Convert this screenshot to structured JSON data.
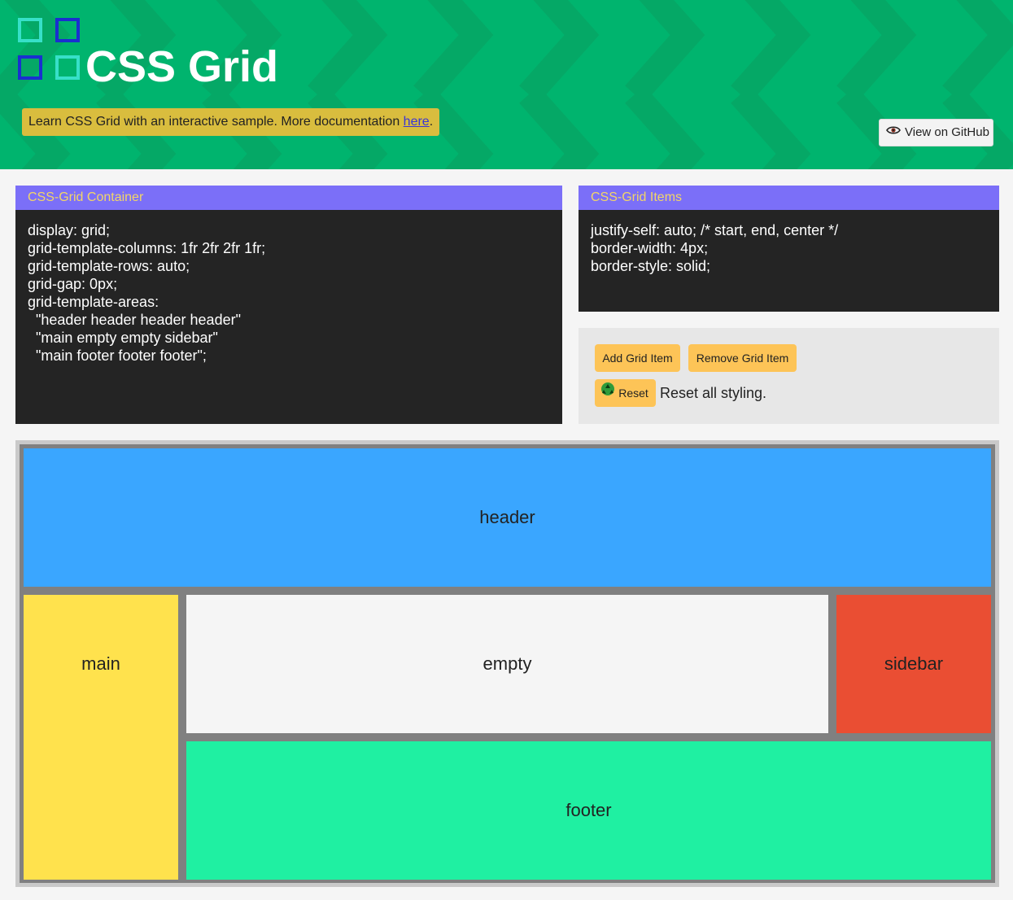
{
  "hero": {
    "title": "CSS Grid",
    "tagline_text": "Learn CSS Grid with an interactive sample. More documentation ",
    "tagline_link": "here",
    "tagline_end": ".",
    "github_button": "View on GitHub",
    "github_icon": "eye-icon",
    "logo_icon": "grid-logo-icon",
    "colors": {
      "background": "#00b46e",
      "chevron": "#06a866",
      "tagline_bg": "#d9bd3e"
    }
  },
  "container_panel": {
    "title": "CSS-Grid Container",
    "lines": [
      "display: grid;",
      "grid-template-columns: 1fr 2fr 2fr 1fr;",
      "grid-template-rows: auto;",
      "grid-gap: 0px;",
      "grid-template-areas:",
      "  \"header header header header\"",
      "  \"main empty empty sidebar\"",
      "  \"main footer footer footer\";"
    ]
  },
  "items_panel": {
    "title": "CSS-Grid Items",
    "lines": [
      "justify-self: auto; /* start, end, center */",
      "border-width: 4px;",
      "border-style: solid;"
    ]
  },
  "controls": {
    "add_button": "Add Grid Item",
    "remove_button": "Remove Grid Item",
    "reset_button": "Reset",
    "reset_icon": "recycle-icon",
    "reset_description": "Reset all styling."
  },
  "grid_items": {
    "header": {
      "label": "header",
      "color": "#3aa6ff"
    },
    "main": {
      "label": "main",
      "color": "#ffe24d"
    },
    "empty": {
      "label": "empty",
      "color": "#f5f5f5"
    },
    "sidebar": {
      "label": "sidebar",
      "color": "#ea4e33"
    },
    "footer": {
      "label": "footer",
      "color": "#1ff0a2"
    }
  }
}
